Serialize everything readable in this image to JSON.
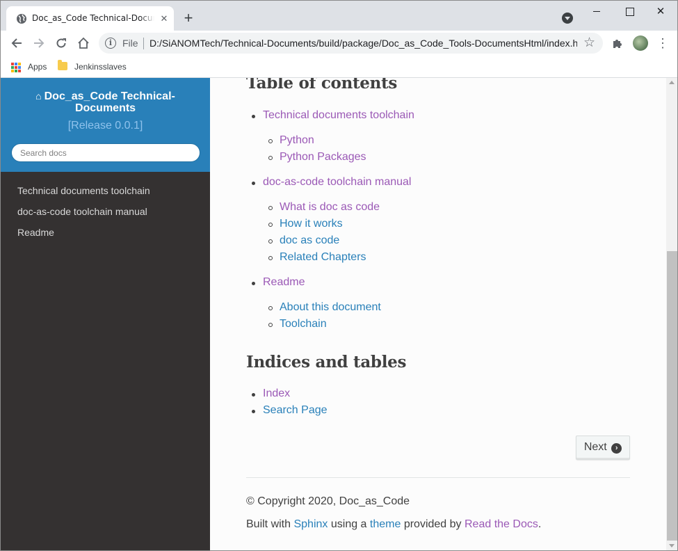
{
  "browser": {
    "tab_title": "Doc_as_Code Technical-Documents",
    "scheme": "File",
    "url": "D:/SiANOMTech/Technical-Documents/build/package/Doc_as_Code_Tools-DocumentsHtml/index.html",
    "bookmarks": [
      {
        "label": "Apps",
        "icon": "apps-grid-icon"
      },
      {
        "label": "Jenkinsslaves",
        "icon": "folder-icon"
      }
    ],
    "colors": {
      "tabstrip": "#dee1e6",
      "omnibox": "#f1f3f4"
    }
  },
  "sidebar": {
    "project_title": "Doc_as_Code Technical-Documents",
    "release": "[Release 0.0.1]",
    "search_placeholder": "Search docs",
    "items": [
      {
        "label": "Technical documents toolchain"
      },
      {
        "label": "doc-as-code toolchain manual"
      },
      {
        "label": "Readme"
      }
    ],
    "colors": {
      "header": "#2980b9",
      "background": "#343131"
    }
  },
  "main": {
    "toc_heading": "Table of contents",
    "toc": [
      {
        "label": "Technical documents toolchain",
        "visited": true,
        "children": [
          {
            "label": "Python",
            "visited": true
          },
          {
            "label": "Python Packages",
            "visited": true
          }
        ]
      },
      {
        "label": "doc-as-code toolchain manual",
        "visited": true,
        "children": [
          {
            "label": "What is doc as code",
            "visited": true
          },
          {
            "label": "How it works",
            "visited": false
          },
          {
            "label": "doc as code",
            "visited": false
          },
          {
            "label": "Related Chapters",
            "visited": false
          }
        ]
      },
      {
        "label": "Readme",
        "visited": true,
        "children": [
          {
            "label": "About this document",
            "visited": false
          },
          {
            "label": "Toolchain",
            "visited": false
          }
        ]
      }
    ],
    "indices_heading": "Indices and tables",
    "indices": [
      {
        "label": "Index",
        "visited": true
      },
      {
        "label": "Search Page",
        "visited": false
      }
    ],
    "next_label": "Next",
    "footer": {
      "copyright": "© Copyright 2020, Doc_as_Code",
      "built_prefix": "Built with",
      "sphinx": "Sphinx",
      "using": "using a",
      "theme": "theme",
      "provided": "provided by",
      "rtd": "Read the Docs",
      "period": "."
    },
    "colors": {
      "link": "#2980b9",
      "visited": "#9b59b6",
      "text": "#404040"
    }
  }
}
